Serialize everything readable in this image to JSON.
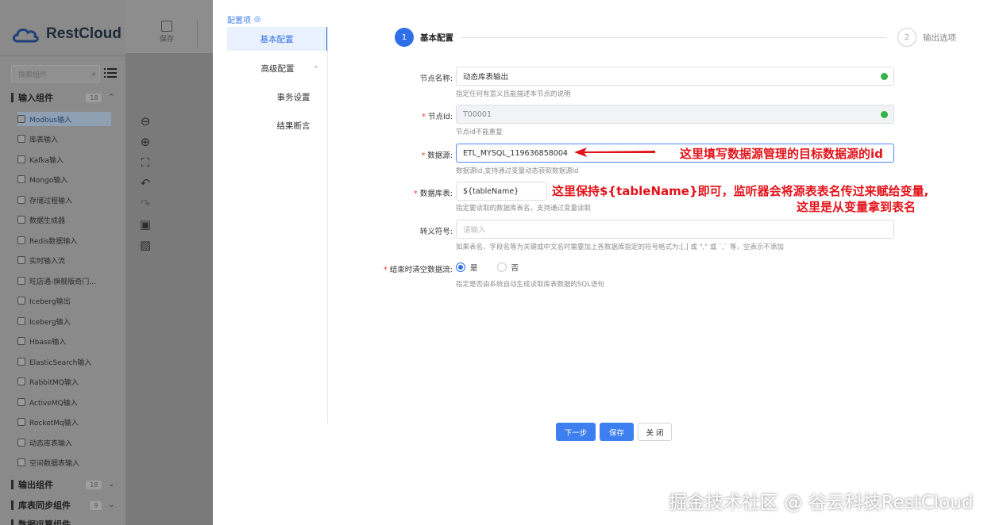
{
  "app": {
    "brand": "RestCloud",
    "toolbar": {
      "save_label": "保存"
    },
    "search_placeholder": "搜索组件",
    "groups": [
      {
        "name": "输入组件",
        "count": "18"
      },
      {
        "name": "输出组件",
        "count": "18"
      },
      {
        "name": "库表同步组件",
        "count": "9"
      },
      {
        "name": "数据运算组件",
        "count": ""
      }
    ],
    "components": [
      "Modbus输入",
      "库表输入",
      "Kafka输入",
      "Mongo输入",
      "存储过程输入",
      "数据生成器",
      "Redis数据输入",
      "实时输入流",
      "旺店通-旗舰版奇门…",
      "Iceberg输出",
      "Iceberg输入",
      "Hbase输入",
      "ElasticSearch输入",
      "RabbitMQ输入",
      "ActiveMQ输入",
      "RocketMq输入",
      "动态库表输入",
      "空间数据表输入"
    ]
  },
  "dialog": {
    "config_title": "配置项",
    "nav": [
      {
        "label": "基本配置"
      },
      {
        "label": "高级配置"
      },
      {
        "label": "事务设置"
      },
      {
        "label": "结果断言"
      }
    ],
    "steps": [
      {
        "num": "1",
        "label": "基本配置"
      },
      {
        "num": "2",
        "label": "输出选项"
      }
    ],
    "form": {
      "node_name": {
        "label": "节点名称:",
        "value": "动态库表输出",
        "help": "指定任何有意义且能描述本节点的说明"
      },
      "node_id": {
        "label": "节点Id:",
        "value": "T00001",
        "help": "节点id不能重复"
      },
      "datasource": {
        "label": "数据源:",
        "value": "ETL_MYSQL_119636858004",
        "help": "数据源Id,支持通过变量动态获取数据源Id"
      },
      "table": {
        "label": "数据库表:",
        "value": "${tableName}",
        "help": "指定要读取的数据库表名，支持通过变量读取"
      },
      "escape": {
        "label": "转义符号:",
        "placeholder": "请输入",
        "help": "如果表名、字段名等为关键或中文名时需要加上各数据库指定的符号格式为:[,] 或 \",\" 或 `,` 等，空表示不添加"
      },
      "clear": {
        "label": "结束时清空数据流:",
        "yes": "是",
        "no": "否",
        "help": "指定是否由系统自动生成读取库表数据的SQL语句"
      }
    },
    "buttons": {
      "next": "下一步",
      "save": "保存",
      "close": "关 闭"
    }
  },
  "annotations": {
    "a1": "这里填写数据源管理的目标数据源的id",
    "a2_line1": "这里保持${tableName}即可，监听器会将源表表名传过来赋给变量,",
    "a2_line2": "这里是从变量拿到表名"
  },
  "watermark": "掘金技术社区 @ 谷云科技RestCloud",
  "colors": {
    "primary": "#2f6fe8",
    "annotation": "#e3131a",
    "success": "#35b34a"
  }
}
